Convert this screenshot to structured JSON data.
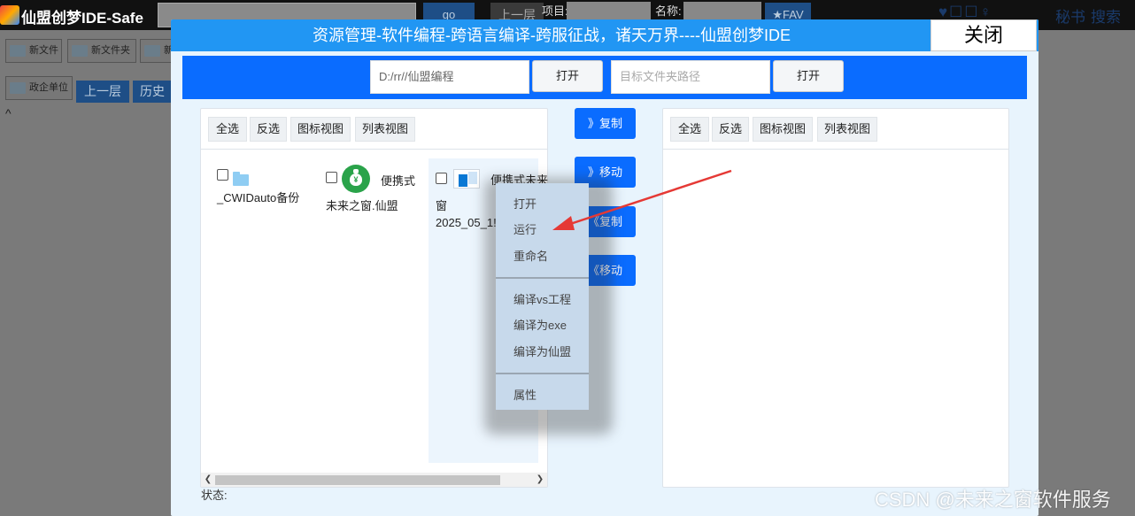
{
  "app": {
    "title": "仙盟创梦IDE-Safe",
    "go_label": "go",
    "up_label": "上一层",
    "project_label": "项目:",
    "name_label": "名称:",
    "fav_label": "★FAV",
    "icons": "♥☐☐♀",
    "secretary_label": "秘书",
    "search_label": "搜索",
    "toolbar": [
      "新文件",
      "新文件夹",
      "新"
    ],
    "row2_btn": "政企单位",
    "row2_up": "上一层",
    "row2_history": "历史",
    "caret": "^"
  },
  "modal": {
    "title": "资源管理-软件编程-跨语言编译-跨服征战，诸天万界----仙盟创梦IDE",
    "close_label": "关闭",
    "source_path": "D:/rr//仙盟编程",
    "open_label": "打开",
    "target_placeholder": "目标文件夹路径",
    "target_open_label": "打开"
  },
  "left_pane": {
    "toolbar": [
      "全选",
      "反选",
      "图标视图",
      "列表视图"
    ],
    "files": [
      {
        "line1": "",
        "line2": "_CWIDauto备份",
        "icon": "folder-icon"
      },
      {
        "line1": "便携式",
        "line2": "未来之窗.仙盟",
        "icon": "moneybag-icon"
      },
      {
        "line1": "便携式未来",
        "line2": "窗",
        "line3": "2025_05_1!",
        "icon": "app-window-icon"
      }
    ]
  },
  "middle": {
    "buttons": [
      "》复制",
      "》移动",
      "《复制",
      "《移动"
    ]
  },
  "right_pane": {
    "toolbar": [
      "全选",
      "反选",
      "图标视图",
      "列表视图"
    ]
  },
  "status_label": "状态:",
  "context_menu": {
    "items": [
      "打开",
      "运行",
      "重命名",
      "编译vs工程",
      "编译为exe",
      "编译为仙盟",
      "属性"
    ]
  },
  "watermark": "CSDN @未来之窗软件服务",
  "colors": {
    "header_blue": "#2196f3",
    "path_bar_blue": "#0a6cff",
    "arrow_red": "#e53935",
    "menu_bg": "#c7d9eb"
  }
}
